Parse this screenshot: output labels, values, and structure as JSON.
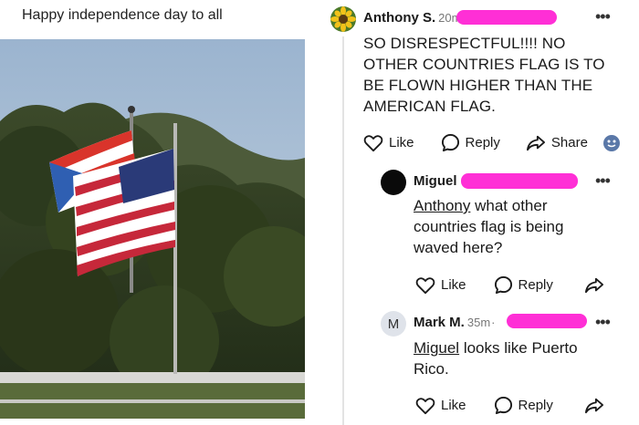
{
  "post": {
    "caption": "Happy independence day to all"
  },
  "comments": [
    {
      "author": "Anthony S.",
      "time": "20m",
      "text": "SO DISRESPECTFUL!!!! NO OTHER COUNTRIES FLAG IS TO BE FLOWN HIGHER THAN THE AMERICAN FLAG.",
      "actions": {
        "like": "Like",
        "reply": "Reply",
        "share": "Share"
      }
    },
    {
      "author": "Miguel",
      "mention": "Anthony",
      "text": " what other countries flag is being waved here?",
      "actions": {
        "like": "Like",
        "reply": "Reply"
      }
    },
    {
      "author": "Mark M.",
      "avatar_letter": "M",
      "time": "35m",
      "mention": "Miguel",
      "text": " looks like Puerto Rico.",
      "actions": {
        "like": "Like",
        "reply": "Reply"
      }
    }
  ],
  "colors": {
    "redaction": "#ff2fd6",
    "thread_line": "#e3e3e3",
    "text": "#1a1a1a"
  },
  "icons": [
    "more-options-icon",
    "heart-icon",
    "reply-bubble-icon",
    "share-arrow-icon",
    "emoji-icon"
  ]
}
